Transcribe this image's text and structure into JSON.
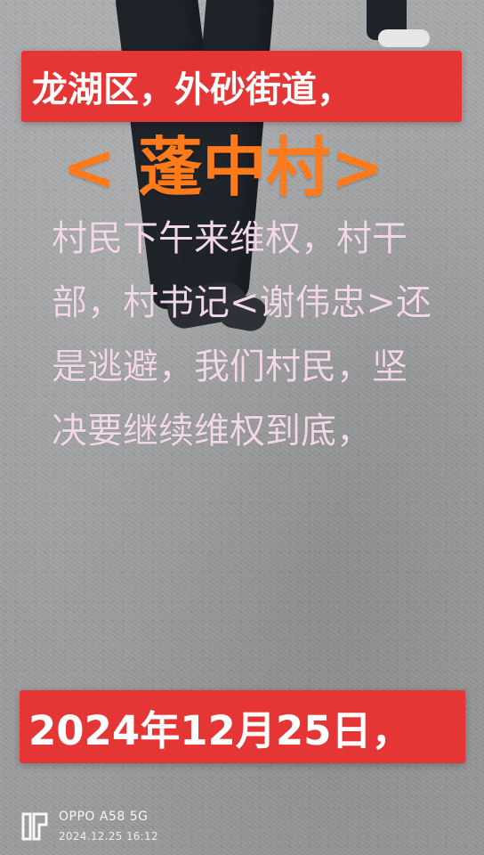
{
  "overlay": {
    "top_banner": "龙湖区，外砂街道，",
    "village": "< 蓬中村>",
    "statement": "村民下午来维权，村干部，村书记<谢伟忠>还是逃避，我们村民，坚决要继续维权到底，",
    "date_banner": "2024年12月25日，"
  },
  "watermark": {
    "device": "OPPO A58 5G",
    "timestamp": "2024.12.25 16:12"
  },
  "colors": {
    "banner_red": "#e53535",
    "village_orange": "#ff7a1a",
    "statement_pink": "#f2d7e7"
  }
}
